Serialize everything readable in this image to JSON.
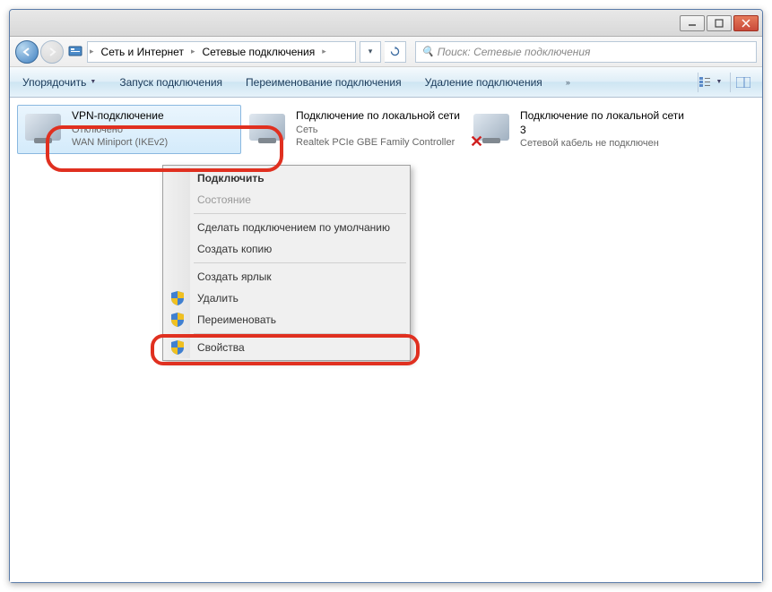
{
  "breadcrumb": {
    "item1": "Сеть и Интернет",
    "item2": "Сетевые подключения"
  },
  "search": {
    "placeholder": "Поиск: Сетевые подключения"
  },
  "toolbar": {
    "organize": "Упорядочить",
    "start": "Запуск подключения",
    "rename": "Переименование подключения",
    "delete": "Удаление подключения"
  },
  "connections": [
    {
      "title": "VPN-подключение",
      "line1": "Отключено",
      "line2": "WAN Miniport (IKEv2)"
    },
    {
      "title": "Подключение по локальной сети",
      "line1": "Сеть",
      "line2": "Realtek PCIe GBE Family Controller"
    },
    {
      "title": "Подключение по локальной сети 3",
      "line1": "Сетевой кабель не подключен",
      "line2": ""
    }
  ],
  "context_menu": {
    "connect": "Подключить",
    "status": "Состояние",
    "set_default": "Сделать подключением по умолчанию",
    "copy": "Создать копию",
    "shortcut": "Создать ярлык",
    "delete": "Удалить",
    "rename": "Переименовать",
    "properties": "Свойства"
  }
}
